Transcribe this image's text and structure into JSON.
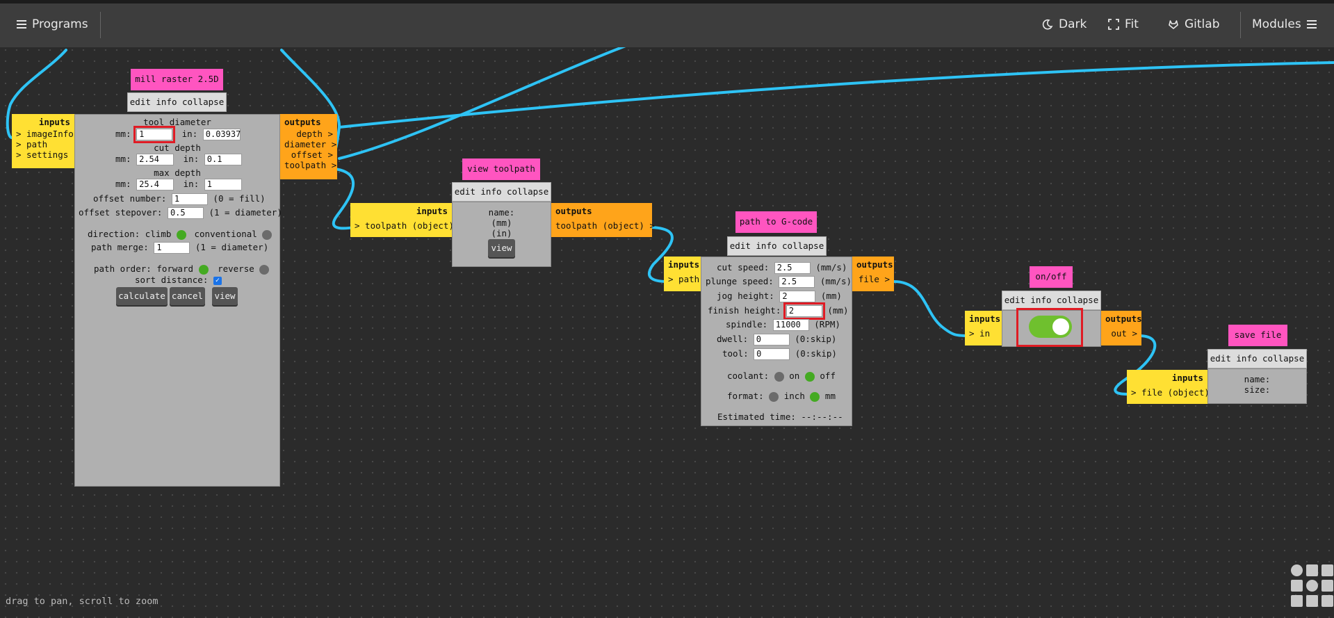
{
  "topbar": {
    "programs_label": "Programs",
    "dark_label": "Dark",
    "fit_label": "Fit",
    "gitlab_label": "Gitlab",
    "modules_label": "Modules"
  },
  "status_text": "drag to pan, scroll to zoom",
  "common": {
    "edit_info_collapse": "edit info collapse",
    "inputs_label": "inputs",
    "outputs_label": "outputs"
  },
  "mill": {
    "title": "mill raster 2.5D",
    "inputs": [
      "> imageInfo",
      "> path",
      "> settings"
    ],
    "outputs": [
      "depth >",
      "diameter >",
      "offset >",
      "toolpath >"
    ],
    "tool_diameter_label": "tool diameter",
    "mm_label": "mm:",
    "in_label": "in:",
    "tool_mm": "1",
    "tool_in": "0.03937",
    "cut_depth_label": "cut depth",
    "cut_mm": "2.54",
    "cut_in": "0.1",
    "max_depth_label": "max depth",
    "max_mm": "25.4",
    "max_in": "1",
    "offset_number_label": "offset number:",
    "offset_number": "1",
    "offset_number_hint": "(0 = fill)",
    "offset_stepover_label": "offset stepover:",
    "offset_stepover": "0.5",
    "offset_stepover_hint": "(1 = diameter)",
    "direction_label": "direction:",
    "climb_label": "climb",
    "conventional_label": "conventional",
    "path_merge_label": "path merge:",
    "path_merge": "1",
    "path_merge_hint": "(1 = diameter)",
    "path_order_label": "path order:",
    "forward_label": "forward",
    "reverse_label": "reverse",
    "sort_distance_label": "sort distance:",
    "calculate_label": "calculate",
    "cancel_label": "cancel",
    "view_label": "view"
  },
  "viewtp": {
    "title": "view toolpath",
    "input": "> toolpath (object)",
    "output": "toolpath (object) >",
    "name_label": "name:",
    "mm_unit": "(mm)",
    "in_unit": "(in)",
    "view_label": "view"
  },
  "gcode": {
    "title": "path to G-code",
    "input": "> path",
    "output": "file >",
    "cut_speed_label": "cut speed:",
    "cut_speed": "2.5",
    "speed_unit": "(mm/s)",
    "plunge_speed_label": "plunge speed:",
    "plunge_speed": "2.5",
    "jog_height_label": "jog height:",
    "jog_height": "2",
    "mm_unit": "(mm)",
    "finish_height_label": "finish height:",
    "finish_height": "2",
    "spindle_label": "spindle:",
    "spindle": "11000",
    "rpm_unit": "(RPM)",
    "dwell_label": "dwell:",
    "dwell": "0",
    "skip_hint": "(0:skip)",
    "tool_label": "tool:",
    "tool": "0",
    "coolant_label": "coolant:",
    "on_label": "on",
    "off_label": "off",
    "format_label": "format:",
    "inch_label": "inch",
    "mm_label": "mm",
    "estimated_label": "Estimated time: --:--:--"
  },
  "onoff": {
    "title": "on/off",
    "input": "> in",
    "output": "out >",
    "toggle_state": "on"
  },
  "savefile": {
    "title": "save file",
    "input": "> file (object)",
    "name_label": "name:",
    "size_label": "size:"
  },
  "colors": {
    "background": "#2b2b2b",
    "topbar": "#3d3d3d",
    "title_bg": "#ff55c0",
    "inputs_bg": "#ffe033",
    "outputs_bg": "#ffa41a",
    "body_bg": "#b0b0b0",
    "wire": "#2ec3f5",
    "toggle": "#6fc02e",
    "highlight": "#e01b24"
  }
}
